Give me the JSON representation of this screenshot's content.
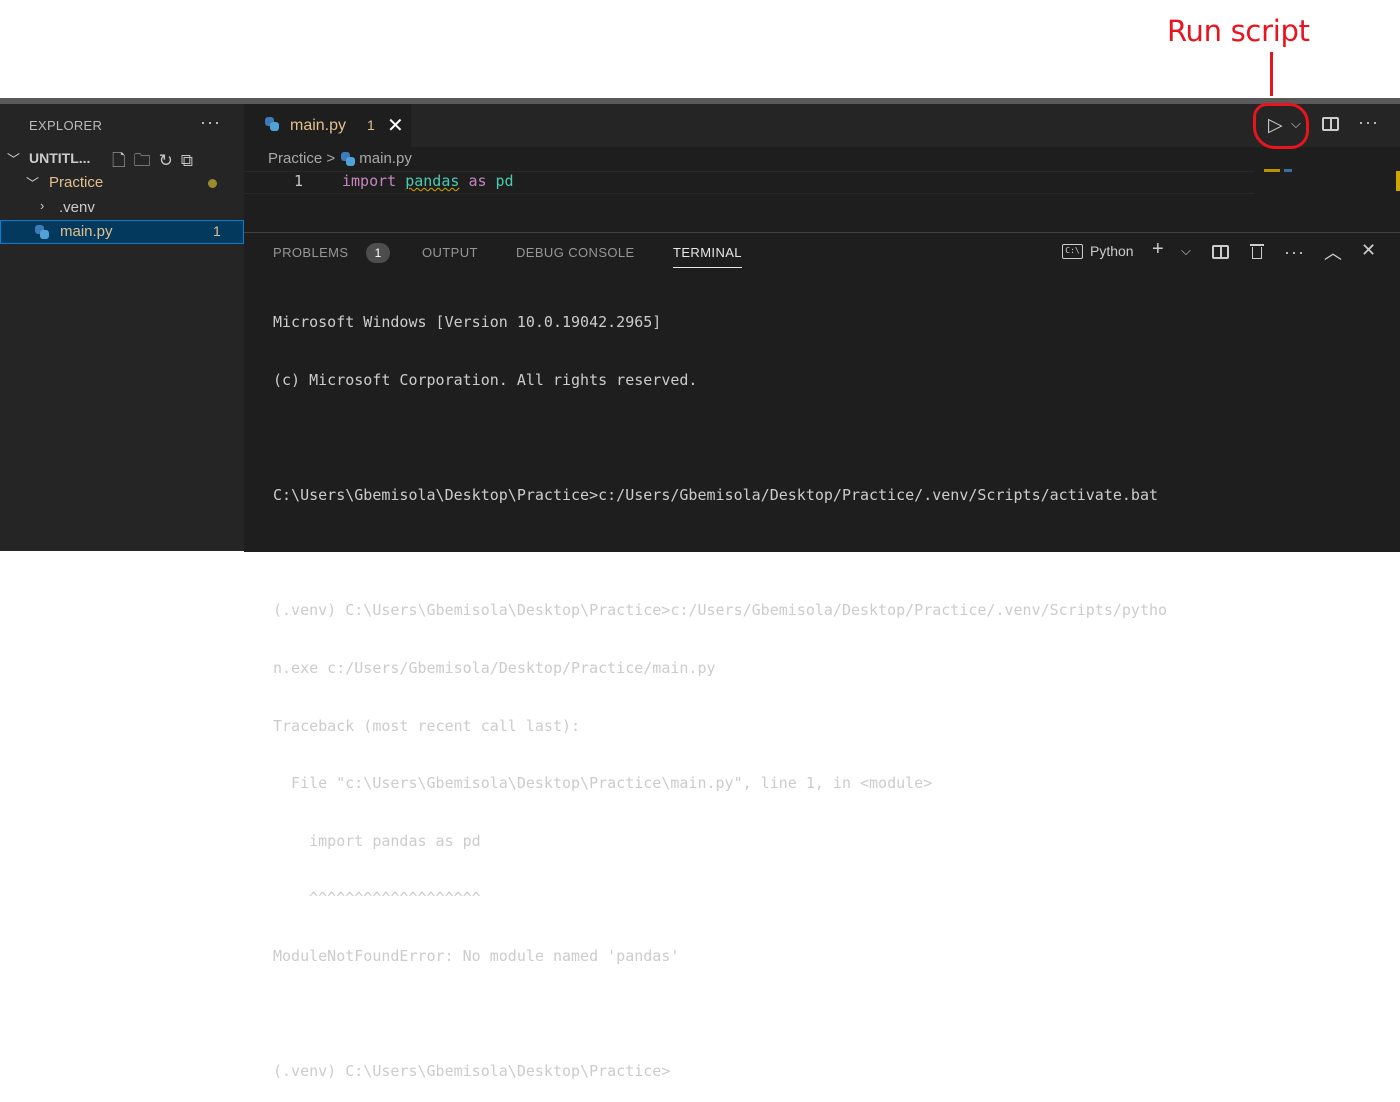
{
  "annotation": {
    "label": "Run script"
  },
  "sidebar": {
    "title": "EXPLORER",
    "more": "···",
    "workspace": "UNTITL...",
    "folder": "Practice",
    "items": [
      {
        "label": ".venv"
      },
      {
        "label": "main.py",
        "badge": "1"
      }
    ]
  },
  "editor": {
    "tab": {
      "label": "main.py",
      "problems": "1",
      "close": "✕"
    },
    "breadcrumb": {
      "folder": "Practice",
      "separator": ">",
      "file": "main.py"
    },
    "line_number": "1",
    "code": {
      "kw1": "import",
      "module": "pandas",
      "kw2": "as",
      "alias": "pd"
    },
    "more": "···"
  },
  "panel": {
    "tabs": [
      "PROBLEMS",
      "OUTPUT",
      "DEBUG CONSOLE",
      "TERMINAL"
    ],
    "problems_count": "1",
    "active_tab": "TERMINAL",
    "terminal_name": "Python",
    "more": "···",
    "terminal_lines": [
      "Microsoft Windows [Version 10.0.19042.2965]",
      "(c) Microsoft Corporation. All rights reserved.",
      "",
      "C:\\Users\\Gbemisola\\Desktop\\Practice>c:/Users/Gbemisola/Desktop/Practice/.venv/Scripts/activate.bat",
      "",
      "(.venv) C:\\Users\\Gbemisola\\Desktop\\Practice>c:/Users/Gbemisola/Desktop/Practice/.venv/Scripts/pytho",
      "n.exe c:/Users/Gbemisola/Desktop/Practice/main.py",
      "Traceback (most recent call last):",
      "  File \"c:\\Users\\Gbemisola\\Desktop\\Practice\\main.py\", line 1, in <module>",
      "    import pandas as pd",
      "    ^^^^^^^^^^^^^^^^^^^",
      "ModuleNotFoundError: No module named 'pandas'",
      "",
      "(.venv) C:\\Users\\Gbemisola\\Desktop\\Practice>"
    ]
  },
  "colors": {
    "annotation_red": "#e8141e",
    "modified_file": "#e2c08d",
    "keyword": "#c586c0",
    "module": "#4ec9b0",
    "selection": "#04395e"
  }
}
